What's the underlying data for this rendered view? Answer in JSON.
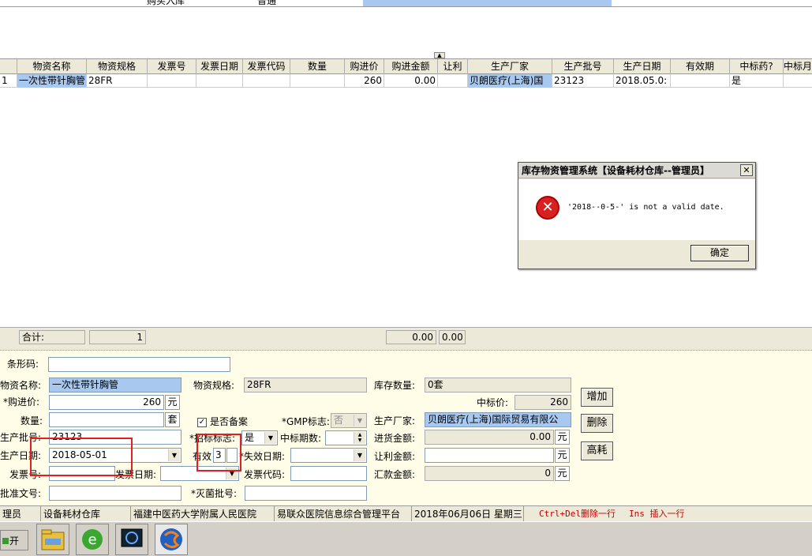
{
  "top_row": {
    "col1": "购买入库",
    "col2": "普通"
  },
  "grid": {
    "headers": [
      "物资名称",
      "物资规格",
      "发票号",
      "发票日期",
      "发票代码",
      "数量",
      "购进价",
      "购进金额",
      "让利",
      "生产厂家",
      "生产批号",
      "生产日期",
      "有效期",
      "中标药?",
      "中标月"
    ],
    "row": {
      "index": "1",
      "name": "一次性带针胸管",
      "spec": "28FR",
      "price": "260",
      "amount": "0.00",
      "maker": "贝朗医疗(上海)国",
      "batch": "23123",
      "prod_date": "2018.05.0:",
      "bid": "是"
    }
  },
  "sumbar": {
    "label": "合计:",
    "count": "1",
    "total1": "0.00",
    "total2": "0.00"
  },
  "form": {
    "barcode_label": "条形码:",
    "name_label": "物资名称:",
    "name_value": "一次性带针胸管",
    "spec_label": "物资规格:",
    "spec_value": "28FR",
    "stock_label": "库存数量:",
    "stock_value": "0套",
    "price_label": "*购进价:",
    "price_value": "260",
    "price_unit": "元",
    "bid_price_label": "中标价:",
    "bid_price_value": "260",
    "qty_label": "数量:",
    "qty_unit": "套",
    "record_label": "是否备案",
    "gmp_label": "*GMP标志:",
    "gmp_value": "否",
    "maker_label": "生产厂家:",
    "maker_value": "贝朗医疗(上海)国际贸易有限公",
    "batch_label": "生产批号:",
    "batch_value": "23123",
    "bidflag_label": "*招标标志:",
    "bidflag_value": "是",
    "bid_periods_label": "中标期数:",
    "purchase_amount_label": "进货金额:",
    "purchase_amount_value": "0.00",
    "purchase_amount_unit": "元",
    "prod_date_label": "生产日期:",
    "prod_date_value": "2018-05-01",
    "valid_label": "有效",
    "valid_value": "3",
    "expire_label": "*失效日期:",
    "discount_label": "让利金额:",
    "discount_unit": "元",
    "invoice_no_label": "发票号:",
    "invoice_date_label": "发票日期:",
    "invoice_code_label": "发票代码:",
    "remit_label": "汇款金额:",
    "remit_value": "0",
    "remit_unit": "元",
    "approval_label": "批准文号:",
    "sterile_label": "*灭菌批号:",
    "btn_add": "增加",
    "btn_delete": "删除",
    "btn_high": "高耗"
  },
  "status": {
    "user": "理员",
    "warehouse": "设备耗材仓库",
    "hospital": "福建中医药大学附属人民医院",
    "platform": "易联众医院信息综合管理平台",
    "date": "2018年06月06日 星期三",
    "hint1": "Ctrl+Del删除一行",
    "hint2": "Ins 插入一行"
  },
  "taskbar": {
    "start": "开始"
  },
  "dialog": {
    "title": "库存物资管理系统【设备耗材仓库--管理员】",
    "message": "'2018--0-5-' is not a valid date.",
    "ok": "确定"
  }
}
